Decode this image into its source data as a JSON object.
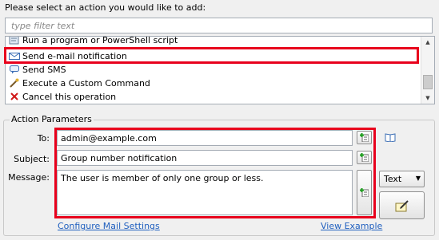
{
  "prompt": "Please select an action you would like to add:",
  "filter": {
    "placeholder": "type filter text"
  },
  "actions": [
    {
      "label": "Run a program or PowerShell script",
      "icon": "script-icon"
    },
    {
      "label": "Send e-mail notification",
      "icon": "email-icon",
      "highlighted": true
    },
    {
      "label": "Send SMS",
      "icon": "sms-icon"
    },
    {
      "label": "Execute a Custom Command",
      "icon": "command-icon"
    },
    {
      "label": "Cancel this operation",
      "icon": "cancel-icon"
    }
  ],
  "params": {
    "legend": "Action Parameters",
    "to": {
      "label": "To:",
      "value": "admin@example.com"
    },
    "subject": {
      "label": "Subject:",
      "value": "Group number notification"
    },
    "message": {
      "label": "Message:",
      "value": "The user is member of only one group or less."
    },
    "format": {
      "selected": "Text"
    },
    "configure_link": "Configure Mail Settings",
    "example_link": "View Example"
  },
  "colors": {
    "highlight": "#e8001c",
    "link": "#1f5fbf"
  }
}
